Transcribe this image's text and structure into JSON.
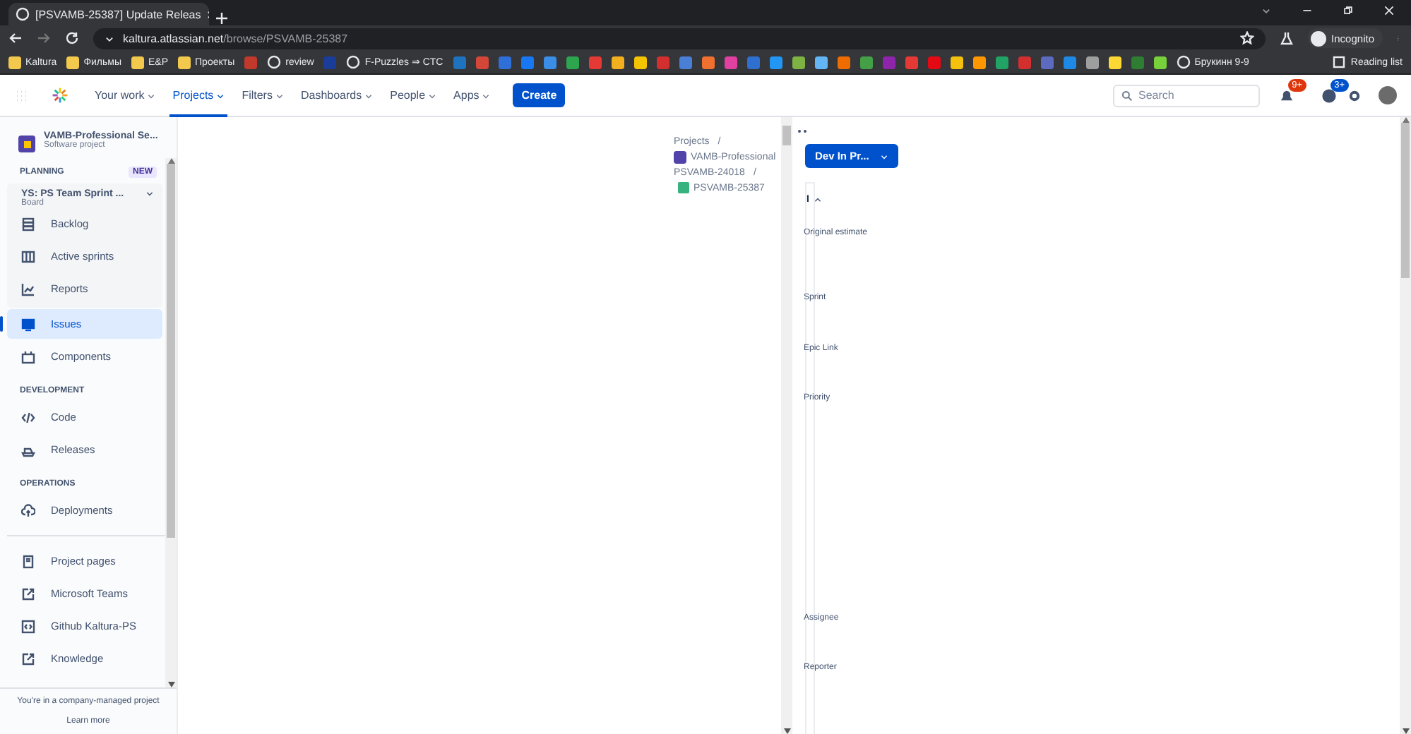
{
  "browser": {
    "tab_title": "[PSVAMB-25387] Update Releas",
    "url_host": "kaltura.atlassian.net",
    "url_path": "/browse/PSVAMB-25387",
    "profile": "Incognito",
    "bookmarks": [
      {
        "kind": "folder",
        "label": "Kaltura"
      },
      {
        "kind": "folder",
        "label": "Фильмы"
      },
      {
        "kind": "folder",
        "label": "E&P"
      },
      {
        "kind": "folder",
        "label": "Проекты"
      },
      {
        "kind": "icon",
        "color": "#c0392b"
      },
      {
        "kind": "site",
        "label": "review"
      },
      {
        "kind": "icon",
        "color": "#1a3d99"
      },
      {
        "kind": "site",
        "label": "F-Puzzles ⇒ CTC"
      },
      {
        "kind": "icon",
        "color": "#1e73be"
      },
      {
        "kind": "icon",
        "color": "#d44638"
      },
      {
        "kind": "icon",
        "color": "#2e6fd8"
      },
      {
        "kind": "icon",
        "color": "#1877f2"
      },
      {
        "kind": "icon",
        "color": "#3a8ee6"
      },
      {
        "kind": "icon",
        "color": "#2da44e"
      },
      {
        "kind": "icon",
        "color": "#e53935"
      },
      {
        "kind": "icon",
        "color": "#f2b01e"
      },
      {
        "kind": "icon",
        "color": "#f5c400"
      },
      {
        "kind": "icon",
        "color": "#d32f2f"
      },
      {
        "kind": "icon",
        "color": "#4a7fd6"
      },
      {
        "kind": "icon",
        "color": "#f07030"
      },
      {
        "kind": "icon",
        "color": "#e040a0"
      },
      {
        "kind": "icon",
        "color": "#2f6fcf"
      },
      {
        "kind": "icon",
        "color": "#2196f3"
      },
      {
        "kind": "icon",
        "color": "#7cb342"
      },
      {
        "kind": "icon",
        "color": "#64b5f6"
      },
      {
        "kind": "icon",
        "color": "#ef6c00"
      },
      {
        "kind": "icon",
        "color": "#43a047"
      },
      {
        "kind": "icon",
        "color": "#8e24aa"
      },
      {
        "kind": "icon",
        "color": "#e53935"
      },
      {
        "kind": "icon",
        "color": "#e50914"
      },
      {
        "kind": "icon",
        "color": "#f4c20d"
      },
      {
        "kind": "icon",
        "color": "#ff9800"
      },
      {
        "kind": "icon",
        "color": "#21a366"
      },
      {
        "kind": "icon",
        "color": "#d32f2f"
      },
      {
        "kind": "icon",
        "color": "#5c6bc0"
      },
      {
        "kind": "icon",
        "color": "#1e88e5"
      },
      {
        "kind": "icon",
        "color": "#9e9e9e"
      },
      {
        "kind": "icon",
        "color": "#fdd835"
      },
      {
        "kind": "icon",
        "color": "#2e7d32"
      },
      {
        "kind": "icon",
        "color": "#76d13b"
      },
      {
        "kind": "site",
        "label": "Брукинн 9-9"
      }
    ],
    "reading_list": "Reading list"
  },
  "nav": {
    "items": [
      {
        "label": "Your work",
        "selected": false
      },
      {
        "label": "Projects",
        "selected": true
      },
      {
        "label": "Filters",
        "selected": false
      },
      {
        "label": "Dashboards",
        "selected": false
      },
      {
        "label": "People",
        "selected": false
      },
      {
        "label": "Apps",
        "selected": false
      }
    ],
    "create": "Create",
    "search": {
      "placeholder": "Search"
    },
    "notifications_badge": "9+",
    "help_badge": "3+"
  },
  "sidebar": {
    "project_name": "VAMB-Professional Se...",
    "project_type": "Software project",
    "sections": [
      {
        "title": "PLANNING",
        "badge": "NEW",
        "board": {
          "name": "YS: PS Team Sprint ...",
          "type": "Board",
          "items": [
            {
              "label": "Backlog",
              "selected": false
            },
            {
              "label": "Active sprints",
              "selected": false
            },
            {
              "label": "Reports",
              "selected": false
            }
          ]
        },
        "items": [
          {
            "label": "Issues",
            "selected": true
          },
          {
            "label": "Components",
            "selected": false
          }
        ]
      },
      {
        "title": "DEVELOPMENT",
        "items": [
          {
            "label": "Code",
            "selected": false
          },
          {
            "label": "Releases",
            "selected": false
          }
        ]
      },
      {
        "title": "OPERATIONS",
        "items": [
          {
            "label": "Deployments",
            "selected": false
          }
        ]
      }
    ],
    "links": [
      {
        "label": "Project pages"
      },
      {
        "label": "Microsoft Teams"
      },
      {
        "label": "Github Kaltura-PS"
      },
      {
        "label": "Knowledge"
      }
    ],
    "footer": "You're in a company-managed project",
    "learn_more": "Learn more"
  },
  "issue": {
    "breadcrumbs": [
      {
        "kind": "text",
        "label": "Projects",
        "separator": "/"
      },
      {
        "kind": "project",
        "label": "VAMB-Professional"
      },
      {
        "kind": "text",
        "label": "PSVAMB-24018",
        "separator": "/"
      },
      {
        "kind": "story",
        "label": "PSVAMB-25387"
      }
    ],
    "status": "Dev In Pr...",
    "details_header": "I",
    "fields": [
      "Original estimate",
      "Sprint",
      "Epic Link",
      "Priority",
      "Assignee",
      "Reporter"
    ]
  }
}
